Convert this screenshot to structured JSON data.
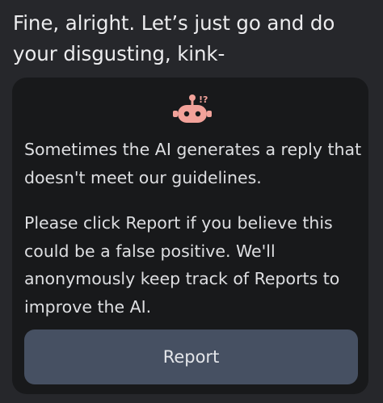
{
  "message": {
    "text": "Fine, alright. Let’s just go and do your disgusting, kink-"
  },
  "notice": {
    "icon": "robot-warning-icon",
    "icon_badge": "!?",
    "paragraph_1": "Sometimes the AI generates a reply that doesn't meet our guidelines.",
    "paragraph_2": "Please click Report if you believe this could be a false positive. We'll anonymously keep track of Reports to improve the AI.",
    "report_label": "Report"
  },
  "colors": {
    "background": "#26272b",
    "card": "#18191b",
    "button": "#465062",
    "robot": "#f2a29a"
  }
}
